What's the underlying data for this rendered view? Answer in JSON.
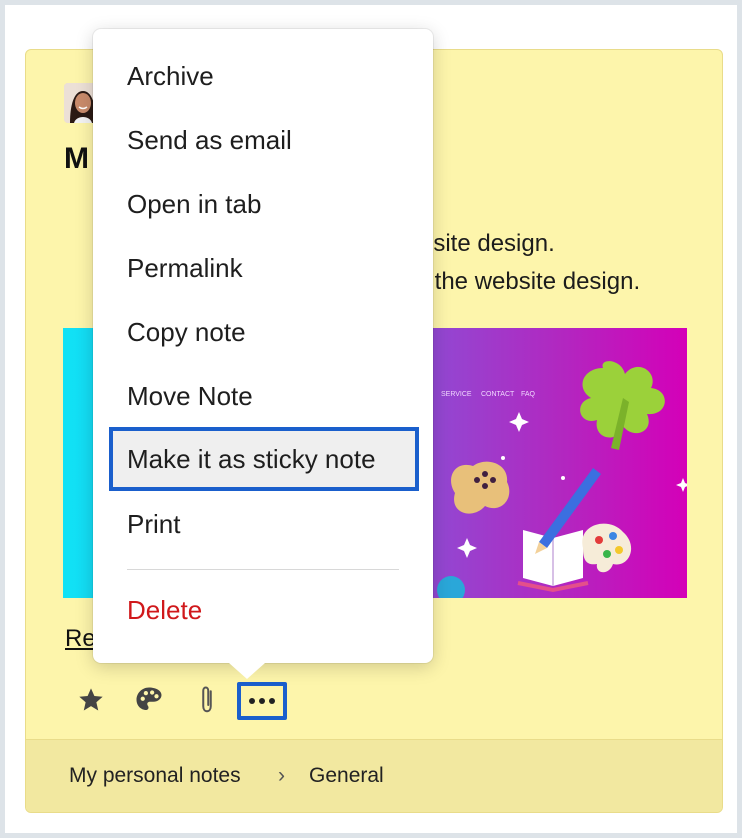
{
  "breadcrumb": {
    "notebook": "My personal notes",
    "separator": "›",
    "section": "General"
  },
  "note": {
    "title_visible": "M",
    "content_line1": "bsite design.",
    "content_line2": "r the website design.",
    "read_more_visible": "Re",
    "image_nav": [
      "SERVICE",
      "CONTACT",
      "FAQ"
    ]
  },
  "toolbar": {
    "icons": [
      "star-icon",
      "palette-icon",
      "paperclip-icon",
      "more-icon"
    ]
  },
  "menu": {
    "items": [
      {
        "label": "Archive"
      },
      {
        "label": "Send as email"
      },
      {
        "label": "Open in tab"
      },
      {
        "label": "Permalink"
      },
      {
        "label": "Copy note"
      },
      {
        "label": "Move Note"
      },
      {
        "label": "Make it as sticky note"
      },
      {
        "label": "Print"
      },
      {
        "label": "Delete"
      }
    ]
  },
  "colors": {
    "card_background": "#fdf5ab",
    "highlight_border": "#1a5fcc",
    "delete_red": "#d0181b"
  }
}
